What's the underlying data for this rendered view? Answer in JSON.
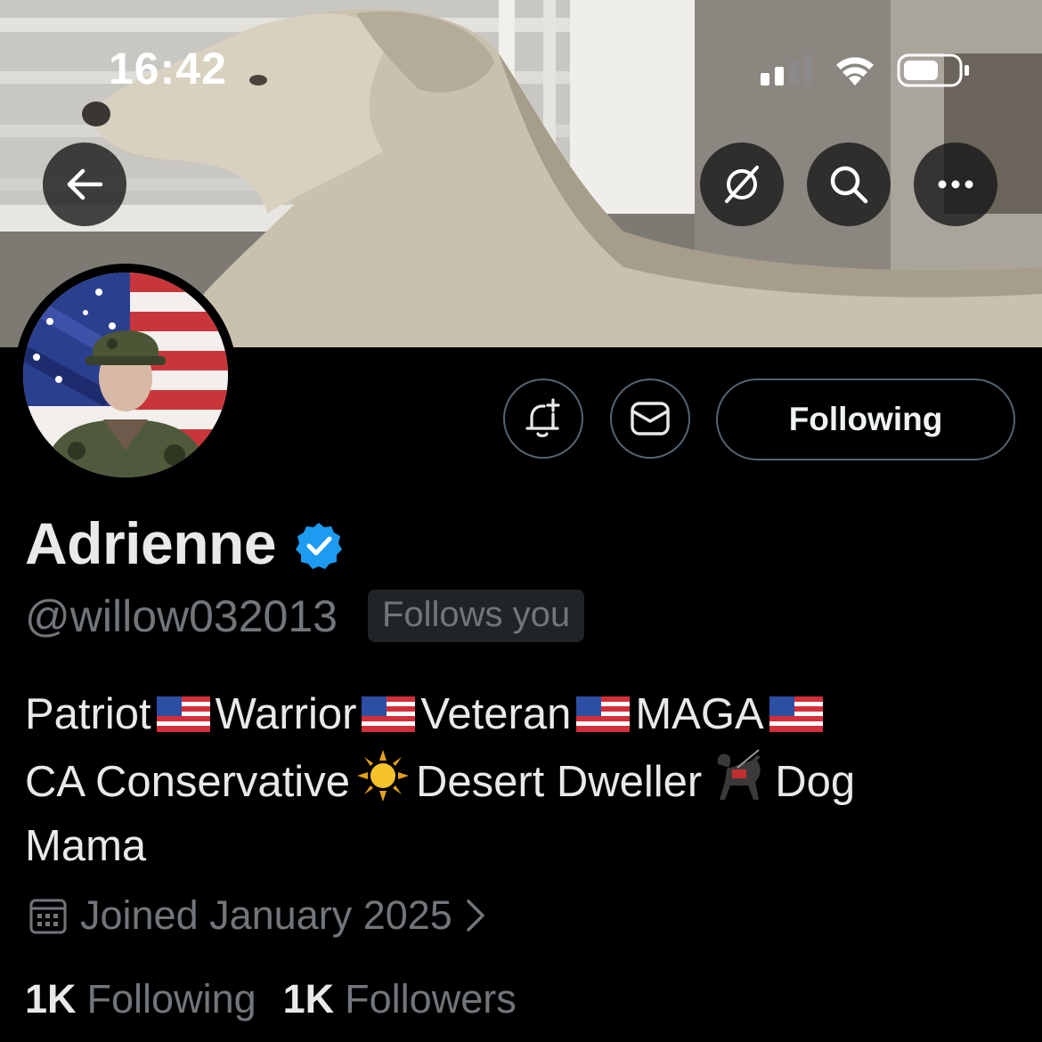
{
  "status_bar": {
    "time": "16:42",
    "icons": [
      "signal-icon",
      "wifi-icon",
      "battery-icon"
    ]
  },
  "header": {
    "back_icon": "arrow-left-icon",
    "grok_icon": "grok-icon",
    "search_icon": "search-icon",
    "more_icon": "more-horizontal-icon"
  },
  "actions": {
    "notify_icon": "bell-plus-icon",
    "message_icon": "envelope-icon",
    "following_label": "Following"
  },
  "profile": {
    "display_name": "Adrienne",
    "verified": true,
    "handle": "@willow032013",
    "follows_you": "Follows you",
    "bio_segments": [
      "Patriot",
      "Warrior",
      "Veteran",
      "MAGA",
      "CA Conservative",
      "Desert Dweller",
      "Dog",
      "Mama"
    ],
    "joined": "Joined January 2025",
    "following_count": "1K",
    "following_label": "Following",
    "followers_count": "1K",
    "followers_label": "Followers"
  },
  "colors": {
    "background": "#000000",
    "primary_text": "#e7e9ea",
    "secondary_text": "#71767b",
    "verified_blue": "#1d9bf0",
    "button_border": "#536471"
  }
}
